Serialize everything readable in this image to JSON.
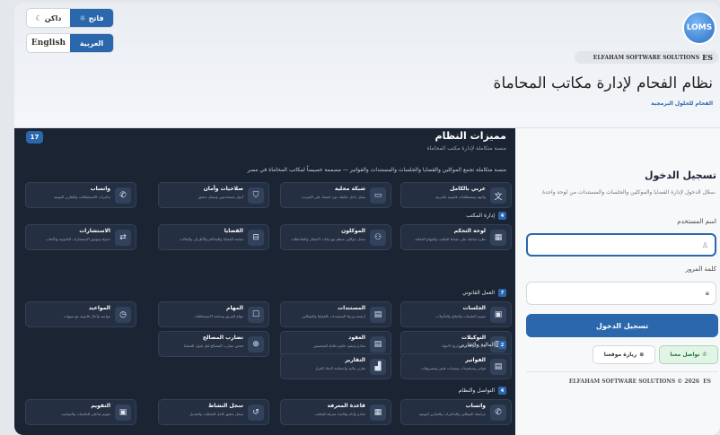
{
  "theme_toggle": {
    "light_label": "فاتح",
    "light_icon": "☼",
    "dark_label": "داكن",
    "dark_icon": "☾"
  },
  "lang_toggle": {
    "arabic_label": "العربية",
    "english_label": "English"
  },
  "brand": {
    "logo_text": "LOMS",
    "company": "ELFAHAM SOFTWARE SOLUTIONS",
    "logo_glyph": "ES",
    "app_title": "نظام الفحام لإدارة مكاتب المحاماة",
    "sub": "الفحام للحلول البرمجية"
  },
  "features": {
    "title": "مميزات النظام",
    "subtitle": "منصة متكاملة لإدارة مكتب المحاماة",
    "count": "17",
    "description": "منصة متكاملة تجمع الموكلين والقضايا والجلسات والمستندات والفواتير — مصممة خصيصاً لمكاتب المحاماة في مصر",
    "top_cards": [
      {
        "icon": "文",
        "icon_name": "translate-icon",
        "title": "عربي بالكامل",
        "desc": "واجهة ومصطلحات قانونية بالعربية"
      },
      {
        "icon": "▭",
        "icon_name": "network-icon",
        "title": "شبكة محلية",
        "desc": "يعمل داخل مكتبك دون اعتماد على الإنترنت"
      },
      {
        "icon": "⛉",
        "icon_name": "shield-icon",
        "title": "صلاحيات وأمان",
        "desc": "أدوار مستخدمين وسجل تدقيق"
      },
      {
        "icon": "✆",
        "icon_name": "whatsapp-icon",
        "title": "واتساب",
        "desc": "تذكيرات الاستحقاقات والتقارير اليومية"
      }
    ],
    "sections": [
      {
        "num": "4",
        "label": "إدارة المكتب",
        "cards": [
          {
            "icon": "▦",
            "icon_name": "dashboard-icon",
            "title": "لوحة التحكم",
            "desc": "نظرة شاملة على نشاط المكتب والمهام العاجلة"
          },
          {
            "icon": "⚇",
            "icon_name": "clients-icon",
            "title": "الموكلون",
            "desc": "سجل موكلين منظم مع بيانات الاتصال والملاحظات"
          },
          {
            "icon": "⊟",
            "icon_name": "briefcase-icon",
            "title": "القضايا",
            "desc": "متابعة القضايا والمحاكم والأطراف والحالات"
          },
          {
            "icon": "⇄",
            "icon_name": "consultation-icon",
            "title": "الاستشارات",
            "desc": "جدولة وتوثيق الاستشارات القانونية والأتعاب"
          }
        ]
      },
      {
        "num": "7",
        "label": "العمل القانوني",
        "cards": [
          {
            "icon": "▣",
            "icon_name": "calendar-icon",
            "title": "الجلسات",
            "desc": "تقويم الجلسات والنتائج والتأجيلات"
          },
          {
            "icon": "▤",
            "icon_name": "document-icon",
            "title": "المستندات",
            "desc": "أرشفة وربط المستندات بالقضايا والموكلين"
          },
          {
            "icon": "☐",
            "icon_name": "tasks-icon",
            "title": "المهام",
            "desc": "مهام الفريق ومتابعة الاستحقاقات"
          },
          {
            "icon": "◷",
            "icon_name": "clock-icon",
            "title": "المواعيد",
            "desc": "مواعيد وآجال قانونية مع تنبيهات"
          },
          {
            "icon": "▥",
            "icon_name": "poa-icon",
            "title": "التوكيلات",
            "desc": "إدارة التوكيلات وتواريخ الانتهاء"
          },
          {
            "icon": "▤",
            "icon_name": "contract-icon",
            "title": "العقود",
            "desc": "نماذج وعقود جاهزة قابلة للتخصيص"
          },
          {
            "icon": "⊕",
            "icon_name": "conflict-icon",
            "title": "تضارب المصالح",
            "desc": "فحص تضارب المصالح قبل قبول القضايا"
          }
        ]
      },
      {
        "num": "2",
        "label": "المالية والتقارير",
        "cards": [
          {
            "icon": "▤",
            "icon_name": "invoice-icon",
            "title": "الفواتير",
            "desc": "فواتير ومدفوعات وسندات قبض ومصروفات"
          },
          {
            "icon": "▟",
            "icon_name": "reports-icon",
            "title": "التقارير",
            "desc": "تقارير مالية وإحصائية لاتخاذ القرار"
          }
        ]
      },
      {
        "num": "4",
        "label": "التواصل والنظام",
        "cards": [
          {
            "icon": "✆",
            "icon_name": "whatsapp-icon",
            "title": "واتساب",
            "desc": "مراسلة الموكلين والتذكيرات والتقارير اليومية"
          },
          {
            "icon": "▦",
            "icon_name": "book-icon",
            "title": "قاعدة المعرفة",
            "desc": "نماذج وأدلة وقاعدة معرفة للمكتب"
          },
          {
            "icon": "↺",
            "icon_name": "history-icon",
            "title": "سجل النشاط",
            "desc": "سجل تدقيق كامل للعمليات والتعديل"
          },
          {
            "icon": "▣",
            "icon_name": "calendar-icon",
            "title": "التقويم",
            "desc": "تقويم تفاعلي للجلسات والمواعيد"
          }
        ]
      }
    ]
  },
  "login": {
    "title": "تسجيل الدخول",
    "subtitle": "سجّل الدخول لإدارة القضايا والموكلين والجلسات والمستندات من لوحة واحدة.",
    "username_label": "اسم المستخدم",
    "password_label": "كلمة المرور",
    "submit": "تسجيل الدخول",
    "contact": "تواصل معنا",
    "visit": "زيارة موقعنا",
    "footer": "ELFAHAM SOFTWARE SOLUTIONS © 2026"
  }
}
